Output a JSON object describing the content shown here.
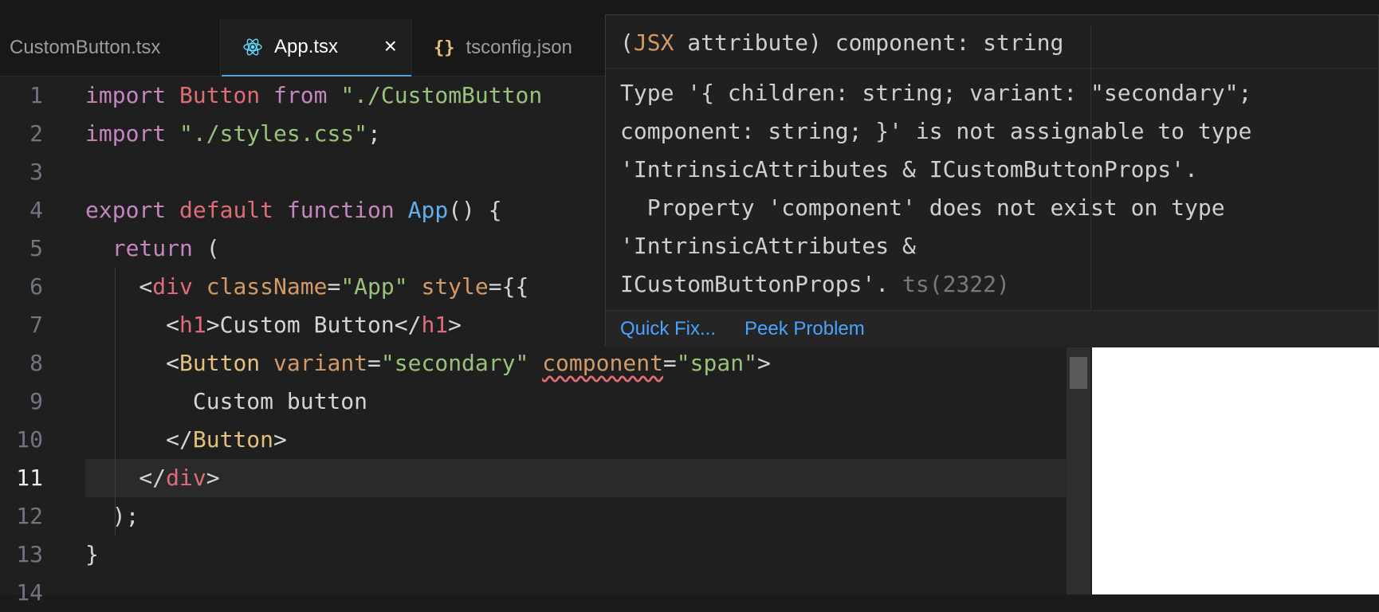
{
  "tabs": [
    {
      "label": "CustomButton.tsx",
      "icon": "none"
    },
    {
      "label": "App.tsx",
      "icon": "react-icon",
      "active": true,
      "close": "×"
    },
    {
      "label": "tsconfig.json",
      "icon": "braces-icon",
      "icon_glyph": "{}"
    }
  ],
  "editor": {
    "line_numbers": [
      "1",
      "2",
      "3",
      "4",
      "5",
      "6",
      "7",
      "8",
      "9",
      "10",
      "11",
      "12",
      "13",
      "14"
    ],
    "active_line": "11",
    "lines": [
      [
        {
          "t": "import",
          "c": "kw"
        },
        {
          "t": " ",
          "c": "punc"
        },
        {
          "t": "Button",
          "c": "kw2"
        },
        {
          "t": " ",
          "c": "punc"
        },
        {
          "t": "from",
          "c": "kw"
        },
        {
          "t": " ",
          "c": "punc"
        },
        {
          "t": "\"./CustomButton",
          "c": "str"
        }
      ],
      [
        {
          "t": "import",
          "c": "kw"
        },
        {
          "t": " ",
          "c": "punc"
        },
        {
          "t": "\"./styles.css\"",
          "c": "str"
        },
        {
          "t": ";",
          "c": "punc"
        }
      ],
      [],
      [
        {
          "t": "export",
          "c": "kw"
        },
        {
          "t": " ",
          "c": "punc"
        },
        {
          "t": "default",
          "c": "kw2"
        },
        {
          "t": " ",
          "c": "punc"
        },
        {
          "t": "function",
          "c": "kw"
        },
        {
          "t": " ",
          "c": "punc"
        },
        {
          "t": "App",
          "c": "fn"
        },
        {
          "t": "() {",
          "c": "punc"
        }
      ],
      [
        {
          "t": "  ",
          "c": "punc"
        },
        {
          "t": "return",
          "c": "kw"
        },
        {
          "t": " (",
          "c": "punc"
        }
      ],
      [
        {
          "t": "    <",
          "c": "punc"
        },
        {
          "t": "div",
          "c": "tag"
        },
        {
          "t": " ",
          "c": "punc"
        },
        {
          "t": "className",
          "c": "attr"
        },
        {
          "t": "=",
          "c": "punc"
        },
        {
          "t": "\"App\"",
          "c": "str"
        },
        {
          "t": " ",
          "c": "punc"
        },
        {
          "t": "style",
          "c": "attr"
        },
        {
          "t": "={{",
          "c": "punc"
        }
      ],
      [
        {
          "t": "      <",
          "c": "punc"
        },
        {
          "t": "h1",
          "c": "tag"
        },
        {
          "t": ">Custom Button</",
          "c": "punc"
        },
        {
          "t": "h1",
          "c": "tag"
        },
        {
          "t": ">",
          "c": "punc"
        }
      ],
      [
        {
          "t": "      <",
          "c": "punc"
        },
        {
          "t": "Button",
          "c": "comp"
        },
        {
          "t": " ",
          "c": "punc"
        },
        {
          "t": "variant",
          "c": "attr"
        },
        {
          "t": "=",
          "c": "punc"
        },
        {
          "t": "\"secondary\"",
          "c": "str"
        },
        {
          "t": " ",
          "c": "punc"
        },
        {
          "t": "component",
          "c": "attr err"
        },
        {
          "t": "=",
          "c": "punc"
        },
        {
          "t": "\"span\"",
          "c": "str"
        },
        {
          "t": ">",
          "c": "punc"
        }
      ],
      [
        {
          "t": "        Custom button",
          "c": "punc"
        }
      ],
      [
        {
          "t": "      </",
          "c": "punc"
        },
        {
          "t": "Button",
          "c": "comp"
        },
        {
          "t": ">",
          "c": "punc"
        }
      ],
      [
        {
          "t": "    </",
          "c": "punc"
        },
        {
          "t": "div",
          "c": "tag"
        },
        {
          "t": ">",
          "c": "punc"
        }
      ],
      [
        {
          "t": "  );",
          "c": "punc"
        }
      ],
      [
        {
          "t": "}",
          "c": "punc"
        }
      ],
      []
    ]
  },
  "hover": {
    "sig_open": "(",
    "sig_jsx": "JSX",
    "sig_rest": " attribute) component: string",
    "message_lines": [
      "Type '{ children: string; variant: \"secondary\";",
      "component: string; }' is not assignable to type",
      "'IntrinsicAttributes & ICustomButtonProps'.",
      "  Property 'component' does not exist on type",
      "'IntrinsicAttributes &",
      "ICustomButtonProps'."
    ],
    "error_code": "ts(2322)",
    "actions": {
      "quick_fix": "Quick Fix...",
      "peek_problem": "Peek Problem"
    }
  },
  "colors": {
    "accent": "#4aa3df",
    "link": "#4aa3ff",
    "error": "#e06c75"
  }
}
